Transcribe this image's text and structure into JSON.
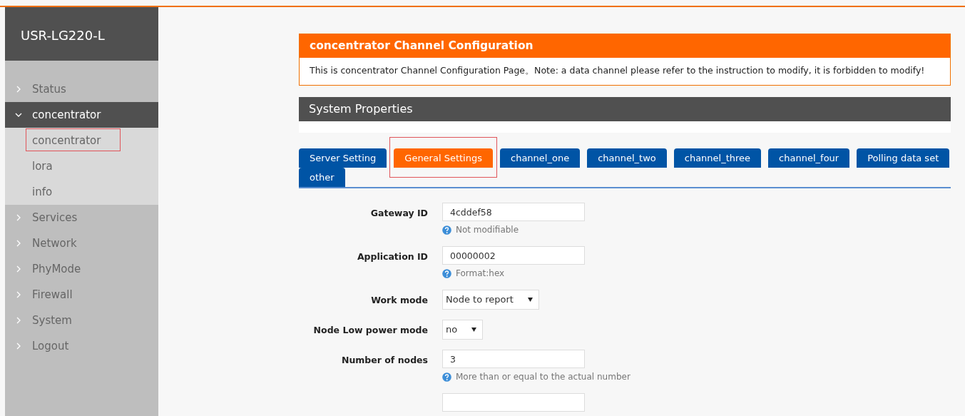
{
  "sidebar": {
    "title": "USR-LG220-L",
    "items": [
      {
        "label": "Status",
        "expanded": false
      },
      {
        "label": "concentrator",
        "expanded": true,
        "children": [
          {
            "label": "concentrator",
            "highlighted": true
          },
          {
            "label": "lora",
            "highlighted": false
          },
          {
            "label": "info",
            "highlighted": false
          }
        ]
      },
      {
        "label": "Services",
        "expanded": false
      },
      {
        "label": "Network",
        "expanded": false
      },
      {
        "label": "PhyMode",
        "expanded": false
      },
      {
        "label": "Firewall",
        "expanded": false
      },
      {
        "label": "System",
        "expanded": false
      },
      {
        "label": "Logout",
        "expanded": false
      }
    ]
  },
  "notice": {
    "title": "concentrator Channel Configuration",
    "text": "This is concentrator Channel Configuration Page。Note: a data channel please refer to the instruction to modify, it is forbidden to modify!"
  },
  "section": {
    "title": "System Properties"
  },
  "tabs": [
    {
      "label": "Server Setting",
      "selected": false,
      "highlighted": false
    },
    {
      "label": "General Settings",
      "selected": true,
      "highlighted": true
    },
    {
      "label": "channel_one",
      "selected": false,
      "highlighted": false
    },
    {
      "label": "channel_two",
      "selected": false,
      "highlighted": false
    },
    {
      "label": "channel_three",
      "selected": false,
      "highlighted": false
    },
    {
      "label": "channel_four",
      "selected": false,
      "highlighted": false
    },
    {
      "label": "Polling data set",
      "selected": false,
      "highlighted": false
    },
    {
      "label": "other",
      "selected": false,
      "highlighted": false
    }
  ],
  "fields": [
    {
      "kind": "text",
      "label": "Gateway ID",
      "value": "4cddef58",
      "hint": "Not modifiable"
    },
    {
      "kind": "text",
      "label": "Application ID",
      "value": "00000002",
      "hint": "Format:hex"
    },
    {
      "kind": "select",
      "label": "Work mode",
      "value": "Node to report"
    },
    {
      "kind": "select",
      "label": "Node Low power mode",
      "value": "no"
    },
    {
      "kind": "text",
      "label": "Number of nodes",
      "value": "3",
      "hint": "More than or equal to the actual number"
    },
    {
      "kind": "text"
    }
  ]
}
